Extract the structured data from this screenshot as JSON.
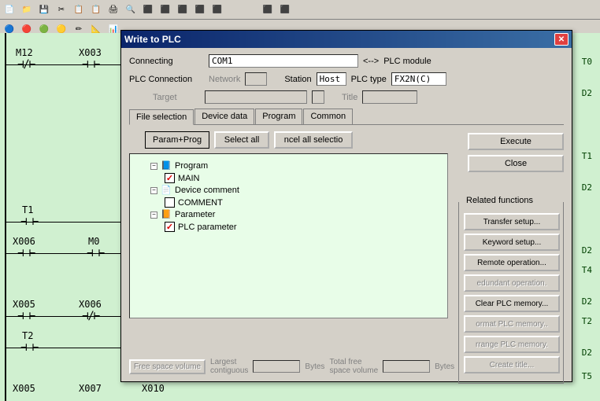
{
  "dialog": {
    "title": "Write to PLC",
    "connecting_label": "Connecting",
    "connecting_value": "COM1",
    "arrow": "<-->",
    "module": "PLC module",
    "plc_connection": "PLC Connection",
    "network_lbl": "Network",
    "station_lbl": "Station",
    "station_value": "Host",
    "plc_type_lbl": "PLC type",
    "plc_type_value": "FX2N(C)",
    "target_lbl": "Target",
    "title_lbl": "Title",
    "tabs": [
      "File selection",
      "Device data",
      "Program",
      "Common"
    ],
    "buttons": {
      "param_prog": "Param+Prog",
      "select_all": "Select all",
      "cancel_sel": "ncel all selectio",
      "execute": "Execute",
      "close": "Close"
    },
    "tree": {
      "program": "Program",
      "main": "MAIN",
      "device_comment": "Device comment",
      "comment": "COMMENT",
      "parameter": "Parameter",
      "plc_parameter": "PLC parameter"
    },
    "related": {
      "legend": "Related functions",
      "transfer": "Transfer setup...",
      "keyword": "Keyword setup...",
      "remote": "Remote operation...",
      "redundant": "edundant operation.",
      "clear": "Clear PLC memory...",
      "format": "ormat PLC memory..",
      "arrange": "rrange PLC memory.",
      "create_title": "Create title..."
    },
    "footer": {
      "free_space": "Free space volume",
      "largest": "Largest",
      "contiguous": "contiguous",
      "bytes": "Bytes",
      "total_free": "Total free",
      "space_volume": "space volume"
    }
  },
  "ladder": {
    "contacts": [
      "M12",
      "X003",
      "T1",
      "X006",
      "M0",
      "X005",
      "X006",
      "T2",
      "X005",
      "X007",
      "X010"
    ],
    "outputs": [
      "T0",
      "D2",
      "T1",
      "D2",
      "D2",
      "T4",
      "D2",
      "T2",
      "D2",
      "T5"
    ]
  }
}
